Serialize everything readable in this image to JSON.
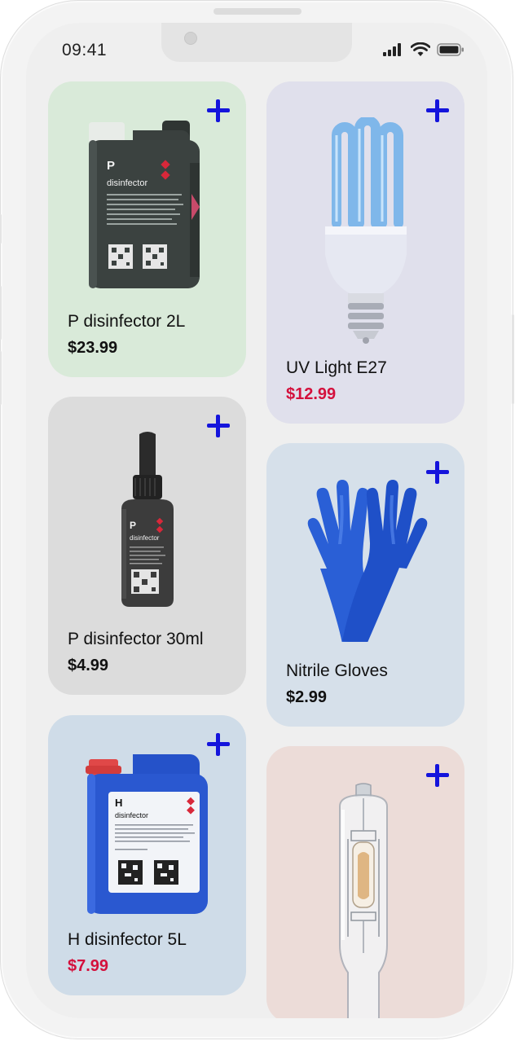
{
  "status_bar": {
    "time": "09:41",
    "icons": [
      "signal-icon",
      "wifi-icon",
      "battery-icon"
    ]
  },
  "colors": {
    "accent_plus": "#1414dc",
    "price_default": "#111111",
    "price_sale": "#d4103c"
  },
  "products": [
    {
      "name": "P disinfector 2L",
      "price": "$23.99",
      "price_color": "#111111",
      "card_color": "#d9ead9",
      "image": "canister-icon"
    },
    {
      "name": "UV Light E27",
      "price": "$12.99",
      "price_color": "#d4103c",
      "card_color": "#e0e0ec",
      "image": "uv-bulb-icon"
    },
    {
      "name": "P disinfector 30ml",
      "price": "$4.99",
      "price_color": "#111111",
      "card_color": "#dcdcdc",
      "image": "dropper-bottle-icon"
    },
    {
      "name": "Nitrile Gloves",
      "price": "$2.99",
      "price_color": "#111111",
      "card_color": "#d6e0ea",
      "image": "gloves-icon"
    },
    {
      "name": "H disinfector 5L",
      "price": "$7.99",
      "price_color": "#d4103c",
      "card_color": "#cfdce8",
      "image": "blue-canister-icon"
    },
    {
      "name": "",
      "price": "",
      "price_color": "#111111",
      "card_color": "#ecdcd8",
      "image": "halide-lamp-icon"
    }
  ],
  "labels": {
    "canister_letter": "P",
    "canister_word": "disinfector",
    "dropper_letter": "P",
    "dropper_word": "disinfector",
    "blue_letter": "H",
    "blue_word": "disinfector"
  }
}
